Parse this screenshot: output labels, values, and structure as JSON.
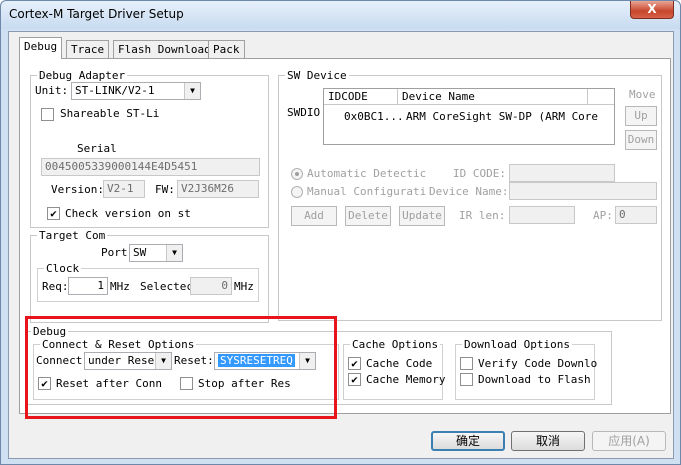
{
  "window": {
    "title": "Cortex-M Target Driver Setup",
    "close_label": "X"
  },
  "tabs": [
    {
      "label": "Debug"
    },
    {
      "label": "Trace"
    },
    {
      "label": "Flash Download"
    },
    {
      "label": "Pack"
    }
  ],
  "debug_adapter": {
    "legend": "Debug Adapter",
    "unit_label": "Unit:",
    "unit_value": "ST-LINK/V2-1",
    "shareable_label": "Shareable ST-Li",
    "shareable_checked": false,
    "serial_label": "Serial",
    "serial_value": "0045005339000144E4D5451",
    "version_label": "Version:",
    "version_value": "V2-1",
    "fw_label": "FW:",
    "fw_value": "V2J36M26",
    "check_version_label": "Check version on st",
    "check_version_checked": true
  },
  "target_com": {
    "legend": "Target Com",
    "port_label": "Port",
    "port_value": "SW",
    "clock_legend": "Clock",
    "req_label": "Req:",
    "req_value": "1",
    "req_unit": "MHz",
    "selected_label": "Selectec",
    "selected_value": "0",
    "selected_unit": "MHz"
  },
  "sw_device": {
    "legend": "SW Device",
    "swdio_label": "SWDIO",
    "columns": [
      "IDCODE",
      "Device Name"
    ],
    "rows": [
      {
        "idcode": "0x0BC1...",
        "device_name": "ARM CoreSight SW-DP (ARM Core"
      }
    ],
    "move_label": "Move",
    "up_label": "Up",
    "down_label": "Down",
    "auto_detect_label": "Automatic Detectic",
    "manual_config_label": "Manual Configurati",
    "id_code_label": "ID CODE:",
    "device_name_label": "Device Name:",
    "add_label": "Add",
    "delete_label": "Delete",
    "update_label": "Update",
    "ir_len_label": "IR len:",
    "ap_label": "AP:",
    "ap_value": "0"
  },
  "debug": {
    "legend": "Debug",
    "connect_reset_legend": "Connect & Reset Options",
    "connect_label": "Connect:",
    "connect_value": "under Reset",
    "reset_label": "Reset:",
    "reset_value": "SYSRESETREQ",
    "reset_after_conn_label": "Reset after Conn",
    "reset_after_conn_checked": true,
    "stop_after_res_label": "Stop after Res",
    "stop_after_res_checked": false,
    "cache_legend": "Cache Options",
    "cache_code_label": "Cache Code",
    "cache_code_checked": true,
    "cache_memory_label": "Cache Memory",
    "cache_memory_checked": true,
    "download_legend": "Download Options",
    "verify_label": "Verify Code Downlo",
    "verify_checked": false,
    "download_flash_label": "Download to Flash",
    "download_flash_checked": false
  },
  "footer": {
    "ok_label": "确定",
    "cancel_label": "取消",
    "apply_label": "应用(A)"
  },
  "colors": {
    "highlight_box": "#e8141b",
    "selection": "#3399ff"
  }
}
